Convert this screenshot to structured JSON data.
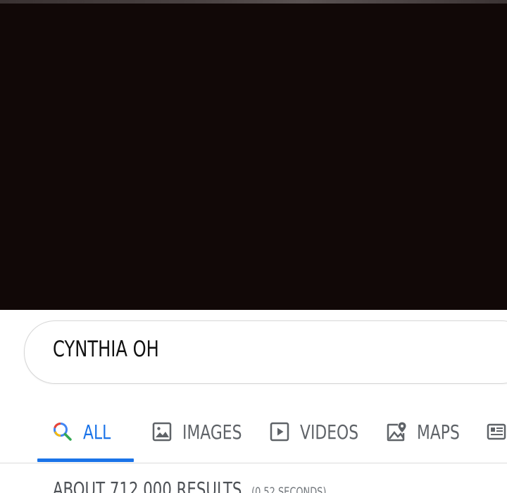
{
  "search": {
    "query": "CYNTHIA OH"
  },
  "tabs": [
    {
      "label": "ALL",
      "icon": "search-icon",
      "active": true
    },
    {
      "label": "IMAGES",
      "icon": "image-icon",
      "active": false
    },
    {
      "label": "VIDEOS",
      "icon": "play-icon",
      "active": false
    },
    {
      "label": "MAPS",
      "icon": "map-pin-icon",
      "active": false
    },
    {
      "label": "",
      "icon": "news-icon",
      "active": false
    }
  ],
  "results": {
    "count_text": "ABOUT 712,000 RESULTS",
    "time_text": "(0.52 SECONDS)"
  },
  "colors": {
    "accent": "#1a73e8",
    "dark_background": "#110807",
    "tab_text": "#5f6368"
  }
}
